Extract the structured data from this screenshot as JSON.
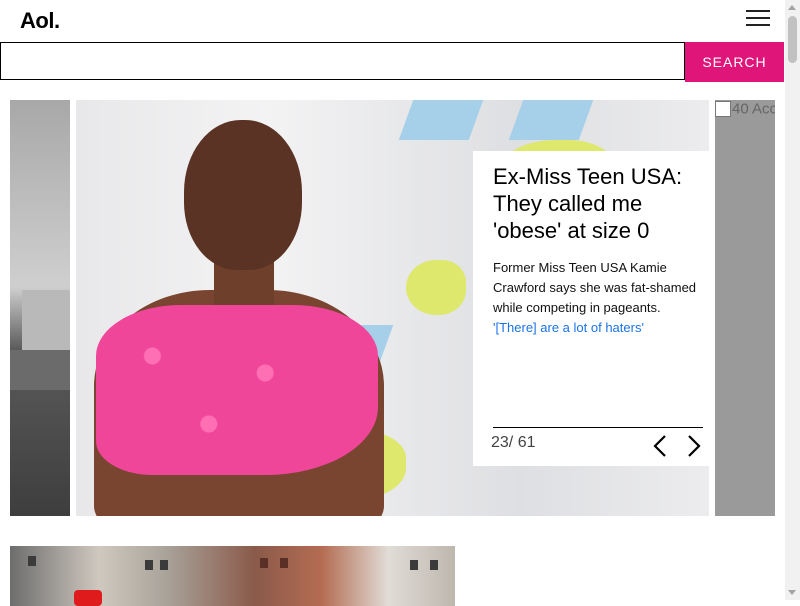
{
  "header": {
    "logo": "Aol."
  },
  "search": {
    "value": "",
    "placeholder": "",
    "button_label": "SEARCH"
  },
  "gallery": {
    "next_slide_alt": "40 Acc",
    "caption": {
      "title": "Ex-Miss Teen USA: They called me 'obese' at size 0",
      "description": "Former Miss Teen USA Kamie Crawford says she was fat-shamed while competing in pageants.",
      "link": "'[There] are a lot of haters'"
    },
    "counter": "23/ 61"
  },
  "colors": {
    "accent": "#e0157a",
    "link": "#1a73e8"
  },
  "icons": {
    "menu": "hamburger-icon",
    "prev": "chevron-left-icon",
    "next": "chevron-right-icon"
  }
}
